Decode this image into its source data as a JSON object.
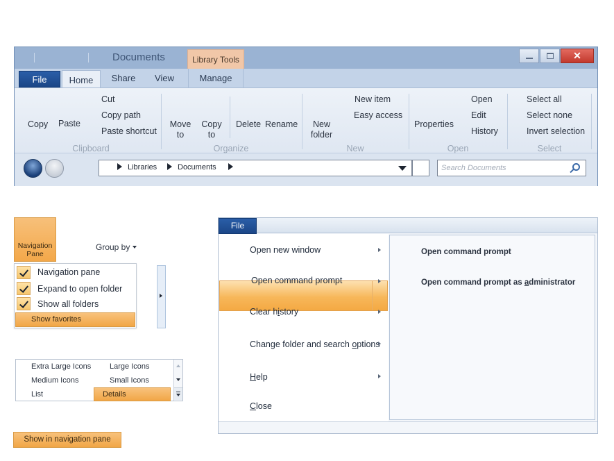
{
  "window": {
    "title": "Documents",
    "contextual_tab_group": "Library Tools",
    "close_glyph": "✕",
    "tabs": {
      "file": "File",
      "home": "Home",
      "share": "Share",
      "view": "View",
      "manage": "Manage"
    },
    "ribbon": {
      "clipboard": {
        "copy": "Copy",
        "paste": "Paste",
        "cut": "Cut",
        "copy_path": "Copy path",
        "paste_shortcut": "Paste shortcut",
        "group": "Clipboard"
      },
      "organize": {
        "move_to": [
          "Move",
          "to"
        ],
        "copy_to": [
          "Copy",
          "to"
        ],
        "delete": "Delete",
        "rename": "Rename",
        "group": "Organize"
      },
      "new": {
        "new_folder": [
          "New",
          "folder"
        ],
        "new_item": "New item",
        "easy_access": "Easy access",
        "group": "New"
      },
      "open": {
        "properties": "Properties",
        "open": "Open",
        "edit": "Edit",
        "history": "History",
        "group": "Open"
      },
      "select": {
        "select_all": "Select all",
        "select_none": "Select none",
        "invert_selection": "Invert selection",
        "group": "Select"
      }
    },
    "address": {
      "crumbs": [
        "Libraries",
        "Documents"
      ]
    },
    "search": {
      "placeholder": "Search Documents"
    }
  },
  "nav_pane": {
    "button_label": [
      "Navigation",
      "Pane"
    ],
    "group_by": "Group by",
    "menu": [
      {
        "label": "Navigation pane",
        "checked": true
      },
      {
        "label": "Expand to open folder",
        "checked": true
      },
      {
        "label": "Show all folders",
        "checked": true
      }
    ],
    "highlighted": "Show favorites"
  },
  "view_layouts": {
    "items": [
      "Extra Large Icons",
      "Large Icons",
      "Medium Icons",
      "Small Icons",
      "List",
      "Details"
    ],
    "selected": "Details"
  },
  "show_in_nav_pane": "Show in navigation pane",
  "file_menu": {
    "file_label": "File",
    "items": [
      {
        "label": "Open new window",
        "submenu": true
      },
      {
        "label": "Open command prompt",
        "submenu": true,
        "highlighted": true
      },
      {
        "pre": "Clear h",
        "ul": "i",
        "post": "story",
        "submenu": true
      },
      {
        "pre": "Change folder and search ",
        "ul": "o",
        "post": "ptions",
        "submenu": true
      },
      {
        "pre": "",
        "ul": "H",
        "post": "elp",
        "submenu": true
      },
      {
        "pre": "",
        "ul": "C",
        "post": "lose",
        "submenu": false
      }
    ],
    "submenu": {
      "item1": "Open command prompt",
      "item2_pre": "Open command prompt as ",
      "item2_ul": "a",
      "item2_post": "dministrator"
    }
  },
  "colors": {
    "accent": "#1b4687",
    "highlight": "#f4a943",
    "title_bar": "#9ab3d3"
  }
}
